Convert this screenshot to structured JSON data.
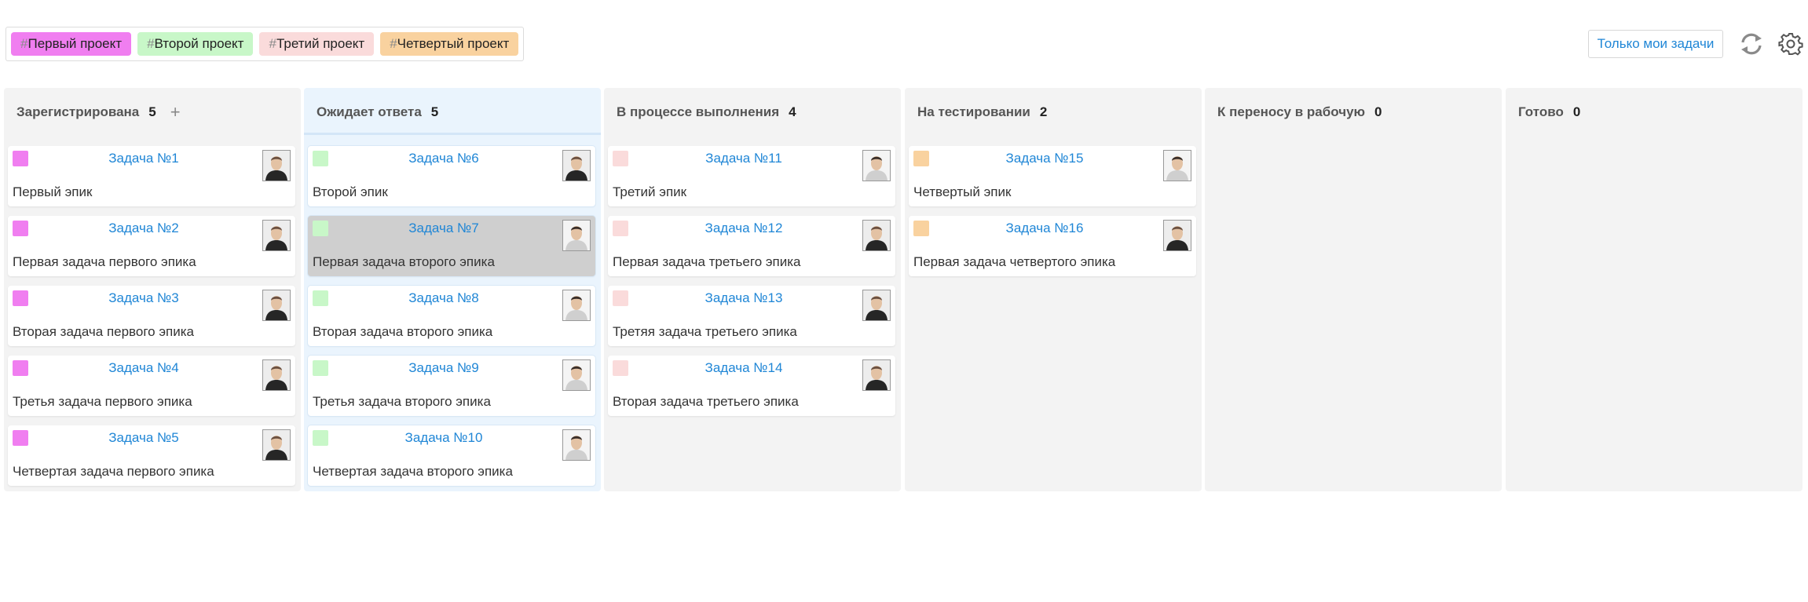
{
  "filters": [
    {
      "hash": "#",
      "label": "Первый проект",
      "color": "#f07ef0"
    },
    {
      "hash": "#",
      "label": "Второй проект",
      "color": "#c8f7c8"
    },
    {
      "hash": "#",
      "label": "Третий проект",
      "color": "#fadbdb"
    },
    {
      "hash": "#",
      "label": "Четвертый проект",
      "color": "#f9d29f"
    }
  ],
  "toolbar": {
    "mine_label": "Только мои задачи",
    "refresh_icon": "refresh-icon",
    "settings_icon": "gear-icon"
  },
  "columns": [
    {
      "title": "Зарегистрирована",
      "count": "5",
      "add": "+",
      "cards": [
        {
          "title": "Задача №1",
          "desc": "Первый эпик",
          "color": "#f07ef0",
          "avatar": "dark"
        },
        {
          "title": "Задача №2",
          "desc": "Первая задача первого эпика",
          "color": "#f07ef0",
          "avatar": "dark"
        },
        {
          "title": "Задача №3",
          "desc": "Вторая задача первого эпика",
          "color": "#f07ef0",
          "avatar": "dark"
        },
        {
          "title": "Задача №4",
          "desc": "Третья задача первого эпика",
          "color": "#f07ef0",
          "avatar": "dark"
        },
        {
          "title": "Задача №5",
          "desc": "Четвертая задача первого эпика",
          "color": "#f07ef0",
          "avatar": "dark"
        }
      ]
    },
    {
      "title": "Ожидает ответа",
      "count": "5",
      "add": "",
      "cards": [
        {
          "title": "Задача №6",
          "desc": "Второй эпик",
          "color": "#c8f7c8",
          "avatar": "dark"
        },
        {
          "title": "Задача №7",
          "desc": "Первая задача второго эпика",
          "color": "#c8f7c8",
          "avatar": "light",
          "selected": true
        },
        {
          "title": "Задача №8",
          "desc": "Вторая задача второго эпика",
          "color": "#c8f7c8",
          "avatar": "light"
        },
        {
          "title": "Задача №9",
          "desc": "Третья задача второго эпика",
          "color": "#c8f7c8",
          "avatar": "light"
        },
        {
          "title": "Задача №10",
          "desc": "Четвертая задача второго эпика",
          "color": "#c8f7c8",
          "avatar": "light"
        }
      ]
    },
    {
      "title": "В процессе выполнения",
      "count": "4",
      "add": "",
      "cards": [
        {
          "title": "Задача №11",
          "desc": "Третий эпик",
          "color": "#fadbdb",
          "avatar": "light"
        },
        {
          "title": "Задача №12",
          "desc": "Первая задача третьего эпика",
          "color": "#fadbdb",
          "avatar": "dark"
        },
        {
          "title": "Задача №13",
          "desc": "Третяя задача третьего эпика",
          "color": "#fadbdb",
          "avatar": "dark"
        },
        {
          "title": "Задача №14",
          "desc": "Вторая задача третьего эпика",
          "color": "#fadbdb",
          "avatar": "dark"
        }
      ]
    },
    {
      "title": "На тестировании",
      "count": "2",
      "add": "",
      "cards": [
        {
          "title": "Задача №15",
          "desc": "Четвертый эпик",
          "color": "#f9d29f",
          "avatar": "light"
        },
        {
          "title": "Задача №16",
          "desc": "Первая задача четвертого эпика",
          "color": "#f9d29f",
          "avatar": "dark"
        }
      ]
    },
    {
      "title": "К переносу в рабочую",
      "count": "0",
      "add": "",
      "cards": []
    },
    {
      "title": "Готово",
      "count": "0",
      "add": "",
      "cards": []
    }
  ]
}
